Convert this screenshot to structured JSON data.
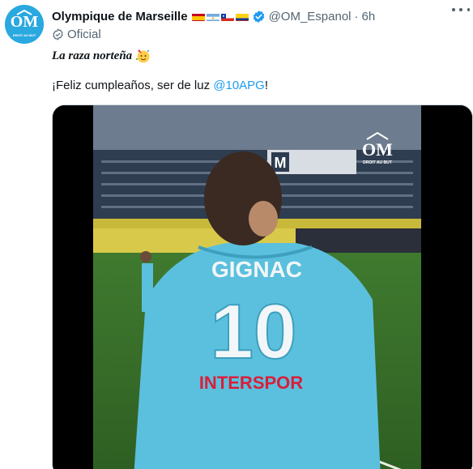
{
  "account": {
    "display_name": "Olympique de Marseille",
    "handle": "@OM_Espanol",
    "separator": "·",
    "time": "6h",
    "label": "Oficial",
    "avatar_icon": "om-crest-icon",
    "verified_icon": "verified-badge-icon",
    "flags": [
      "spain-flag-icon",
      "argentina-flag-icon",
      "chile-flag-icon",
      "colombia-flag-icon"
    ]
  },
  "tweet": {
    "line1": "La raza norteña",
    "line1_emoji": "party-face-emoji",
    "line2_prefix": "¡Feliz cumpleaños, ser de luz ",
    "line2_mention": "@10APG",
    "line2_suffix": "!"
  },
  "media": {
    "type": "video",
    "jersey_name": "GIGNAC",
    "jersey_number": "10",
    "sponsor": "INTERSPOR",
    "watermark": "DROIT AU BUT",
    "stadium_board": "M"
  },
  "colors": {
    "accent": "#1d9bf0",
    "om_blue": "#2aa8e0",
    "jersey": "#5bc0de",
    "secondary_text": "#536471"
  }
}
